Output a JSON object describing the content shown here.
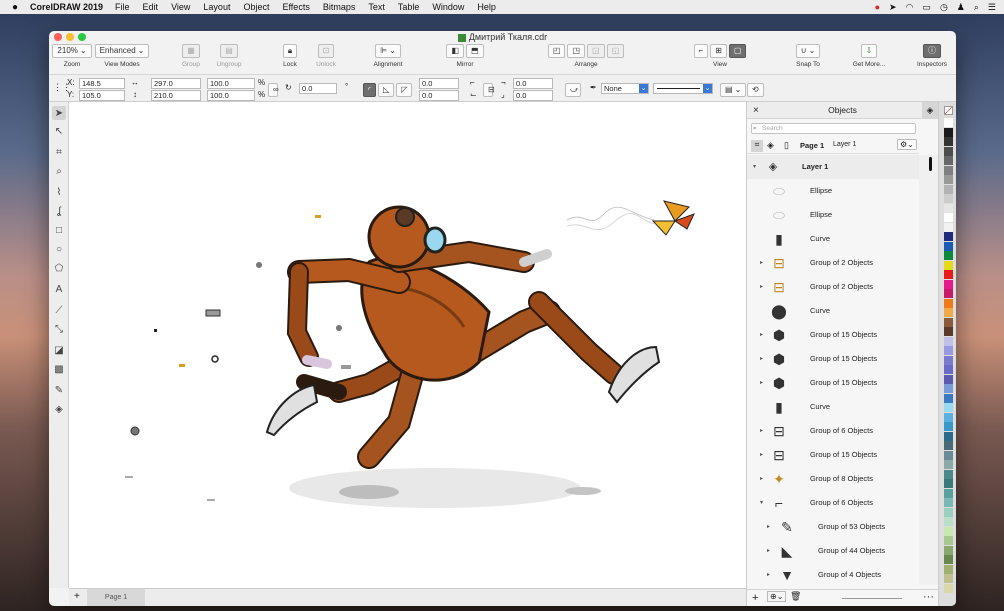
{
  "menubar": {
    "app": "CorelDRAW 2019",
    "items": [
      "File",
      "Edit",
      "View",
      "Layout",
      "Object",
      "Effects",
      "Bitmaps",
      "Text",
      "Table",
      "Window",
      "Help"
    ]
  },
  "window": {
    "title": "Дмитрий Ткаля.cdr"
  },
  "toolbar": {
    "zoom": {
      "value": "210%",
      "label": "Zoom"
    },
    "view_modes": {
      "value": "Enhanced",
      "label": "View Modes"
    },
    "group": "Group",
    "ungroup": "Ungroup",
    "lock": "Lock",
    "unlock": "Unlock",
    "alignment": "Alignment",
    "mirror": "Mirror",
    "arrange": "Arrange",
    "view": "View",
    "snap_to": "Snap To",
    "get_more": "Get More...",
    "inspectors": "Inspectors"
  },
  "propbar": {
    "x": "148.5",
    "y": "105.0",
    "w": "297.0",
    "h": "210.0",
    "sx": "100.0",
    "sy": "100.0",
    "pct": "%",
    "angle": "0.0",
    "deg": "°",
    "f1": "0.0",
    "f2": "0.0",
    "f3": "0.0",
    "f4": "0.0",
    "outline": "None"
  },
  "pagetab": "Page 1",
  "objects": {
    "title": "Objects",
    "search": "Search",
    "page": "Page 1",
    "layer_ref": "Layer 1",
    "items": [
      {
        "name": "Layer 1",
        "bold": true
      },
      {
        "name": "Ellipse"
      },
      {
        "name": "Ellipse"
      },
      {
        "name": "Curve"
      },
      {
        "name": "Group of 2 Objects"
      },
      {
        "name": "Group of 2 Objects"
      },
      {
        "name": "Curve"
      },
      {
        "name": "Group of 15 Objects"
      },
      {
        "name": "Group of 15 Objects"
      },
      {
        "name": "Group of 15 Objects"
      },
      {
        "name": "Curve"
      },
      {
        "name": "Group of 6 Objects"
      },
      {
        "name": "Group of 15 Objects"
      },
      {
        "name": "Group of 8 Objects"
      },
      {
        "name": "Group of 6 Objects"
      },
      {
        "name": "Group of 53 Objects"
      },
      {
        "name": "Group of 44 Objects"
      },
      {
        "name": "Group of 4 Objects"
      }
    ]
  },
  "palette": [
    "#ffffff",
    "#1a1a1a",
    "#333333",
    "#4d4d4d",
    "#666666",
    "#808080",
    "#999999",
    "#b3b3b3",
    "#cccccc",
    "#e6e6e6",
    "#ffffff",
    "#f2f2f2",
    "#1f2a7a",
    "#1b5bb5",
    "#0a8a3a",
    "#e8d81a",
    "#e81a1a",
    "#e81a8a",
    "#c81a6a",
    "#f07a1a",
    "#f0a84a",
    "#8a5a3a",
    "#5a3a2a",
    "#c0c0e8",
    "#9a9ae0",
    "#7a7ad0",
    "#6a6ac8",
    "#5a5ab0",
    "#7a9ad8",
    "#3a7ac0",
    "#9adaf0",
    "#5ab0e0",
    "#3a98c8",
    "#2a6a8a",
    "#4a6a7a",
    "#6a8a9a",
    "#8aaaaa",
    "#4a8a8a",
    "#3a7a7a",
    "#5aa0a0",
    "#7ab8b8",
    "#9ad0c0",
    "#b8e0c8",
    "#c8e8b0",
    "#a8c890",
    "#88a870",
    "#688850",
    "#a0b070",
    "#c0c090",
    "#d8d8a8"
  ]
}
